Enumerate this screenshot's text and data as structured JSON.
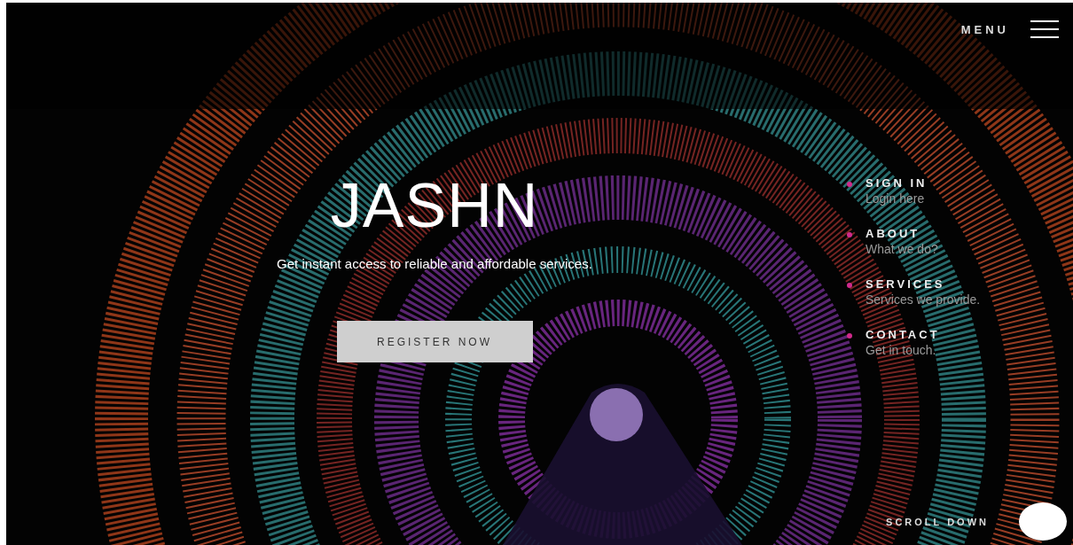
{
  "header": {
    "menu_label": "MENU"
  },
  "hero": {
    "title": "JASHN",
    "tagline": "Get instant access to reliable and affordable services.",
    "button": "REGISTER NOW"
  },
  "nav": [
    {
      "title": "SIGN IN",
      "subtitle": "Login here"
    },
    {
      "title": "ABOUT",
      "subtitle": "What we do?"
    },
    {
      "title": "SERVICES",
      "subtitle": "Services we provide."
    },
    {
      "title": "CONTACT",
      "subtitle": "Get in touch."
    }
  ],
  "scroll": {
    "label": "SCROLL DOWN"
  }
}
